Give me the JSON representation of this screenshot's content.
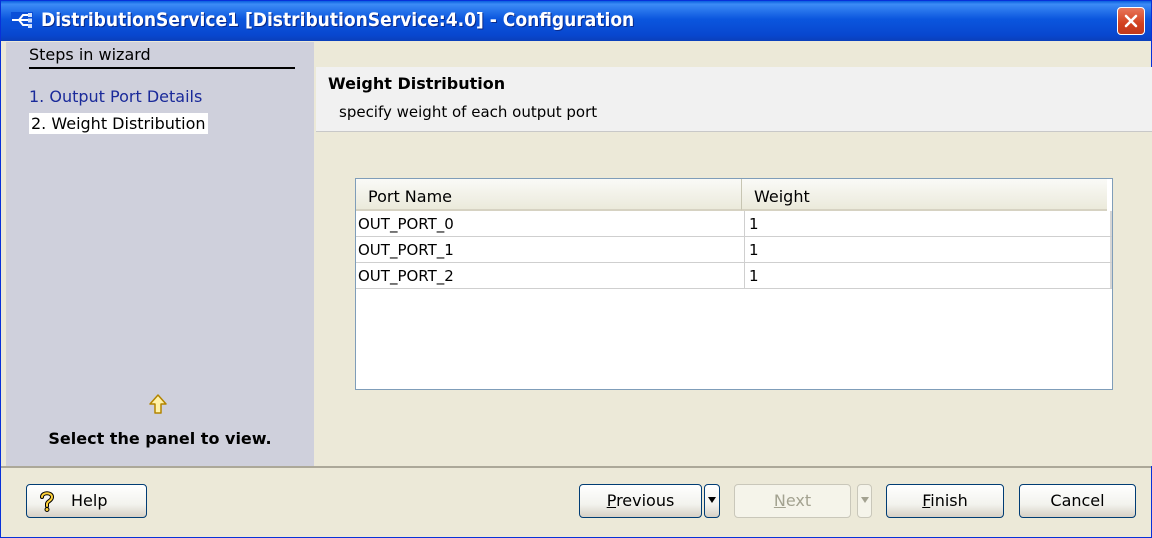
{
  "window": {
    "title": "DistributionService1 [DistributionService:4.0] - Configuration",
    "icon": "distribution-icon",
    "close_icon": "close-icon"
  },
  "steps": {
    "title": "Steps in wizard",
    "items": [
      {
        "label": "1. Output Port Details",
        "current": false
      },
      {
        "label": "2. Weight Distribution",
        "current": true
      }
    ],
    "hint_icon": "arrow-up-icon",
    "hint": "Select the panel to view."
  },
  "panel": {
    "title": "Weight Distribution",
    "subtitle": "specify weight of each output port"
  },
  "table": {
    "columns": [
      "Port Name",
      "Weight"
    ],
    "rows": [
      {
        "port": "OUT_PORT_0",
        "weight": "1"
      },
      {
        "port": "OUT_PORT_1",
        "weight": "1"
      },
      {
        "port": "OUT_PORT_2",
        "weight": "1"
      }
    ]
  },
  "buttons": {
    "help": "Help",
    "previous_u": "P",
    "previous_rest": "revious",
    "next_u": "N",
    "next_rest": "ext",
    "finish_u": "F",
    "finish_rest": "inish",
    "cancel": "Cancel"
  },
  "colors": {
    "titlebar": "#0847cf",
    "left_panel": "#cfd0dc",
    "dialog_bg": "#ece9d8",
    "step_link": "#1a2a9a"
  }
}
